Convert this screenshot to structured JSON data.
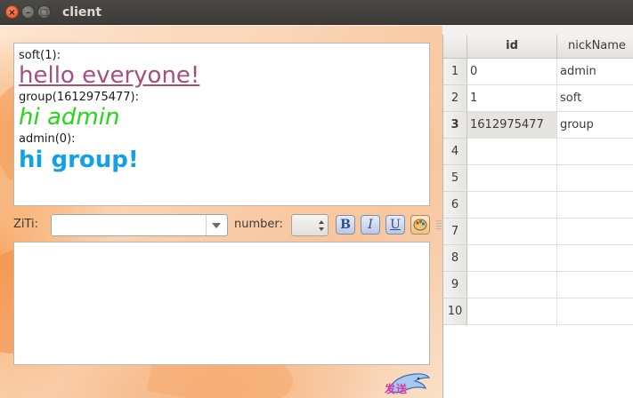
{
  "window": {
    "title": "client"
  },
  "chat": {
    "messages": [
      {
        "header": "soft(1):",
        "body": "hello everyone!"
      },
      {
        "header": "group(1612975477):",
        "body": "hi admin"
      },
      {
        "header": "admin(0):",
        "body": "hi group!"
      }
    ]
  },
  "toolbar": {
    "font_label": "ZiTi:",
    "font_value": "",
    "number_label": "number:",
    "number_value": "",
    "bold_icon": "bold-icon",
    "italic_icon": "italic-icon",
    "underline_icon": "underline-icon",
    "color_icon": "color-palette-icon"
  },
  "input": {
    "value": ""
  },
  "send_button": {
    "label": "发送"
  },
  "table": {
    "columns": [
      "id",
      "nickName"
    ],
    "rows": [
      {
        "num": "1",
        "id": "0",
        "nickName": "admin"
      },
      {
        "num": "2",
        "id": "1",
        "nickName": "soft"
      },
      {
        "num": "3",
        "id": "1612975477",
        "nickName": "group"
      },
      {
        "num": "4",
        "id": "",
        "nickName": ""
      },
      {
        "num": "5",
        "id": "",
        "nickName": ""
      },
      {
        "num": "6",
        "id": "",
        "nickName": ""
      },
      {
        "num": "7",
        "id": "",
        "nickName": ""
      },
      {
        "num": "8",
        "id": "",
        "nickName": ""
      },
      {
        "num": "9",
        "id": "",
        "nickName": ""
      },
      {
        "num": "10",
        "id": "",
        "nickName": ""
      }
    ],
    "current_row": 3
  }
}
